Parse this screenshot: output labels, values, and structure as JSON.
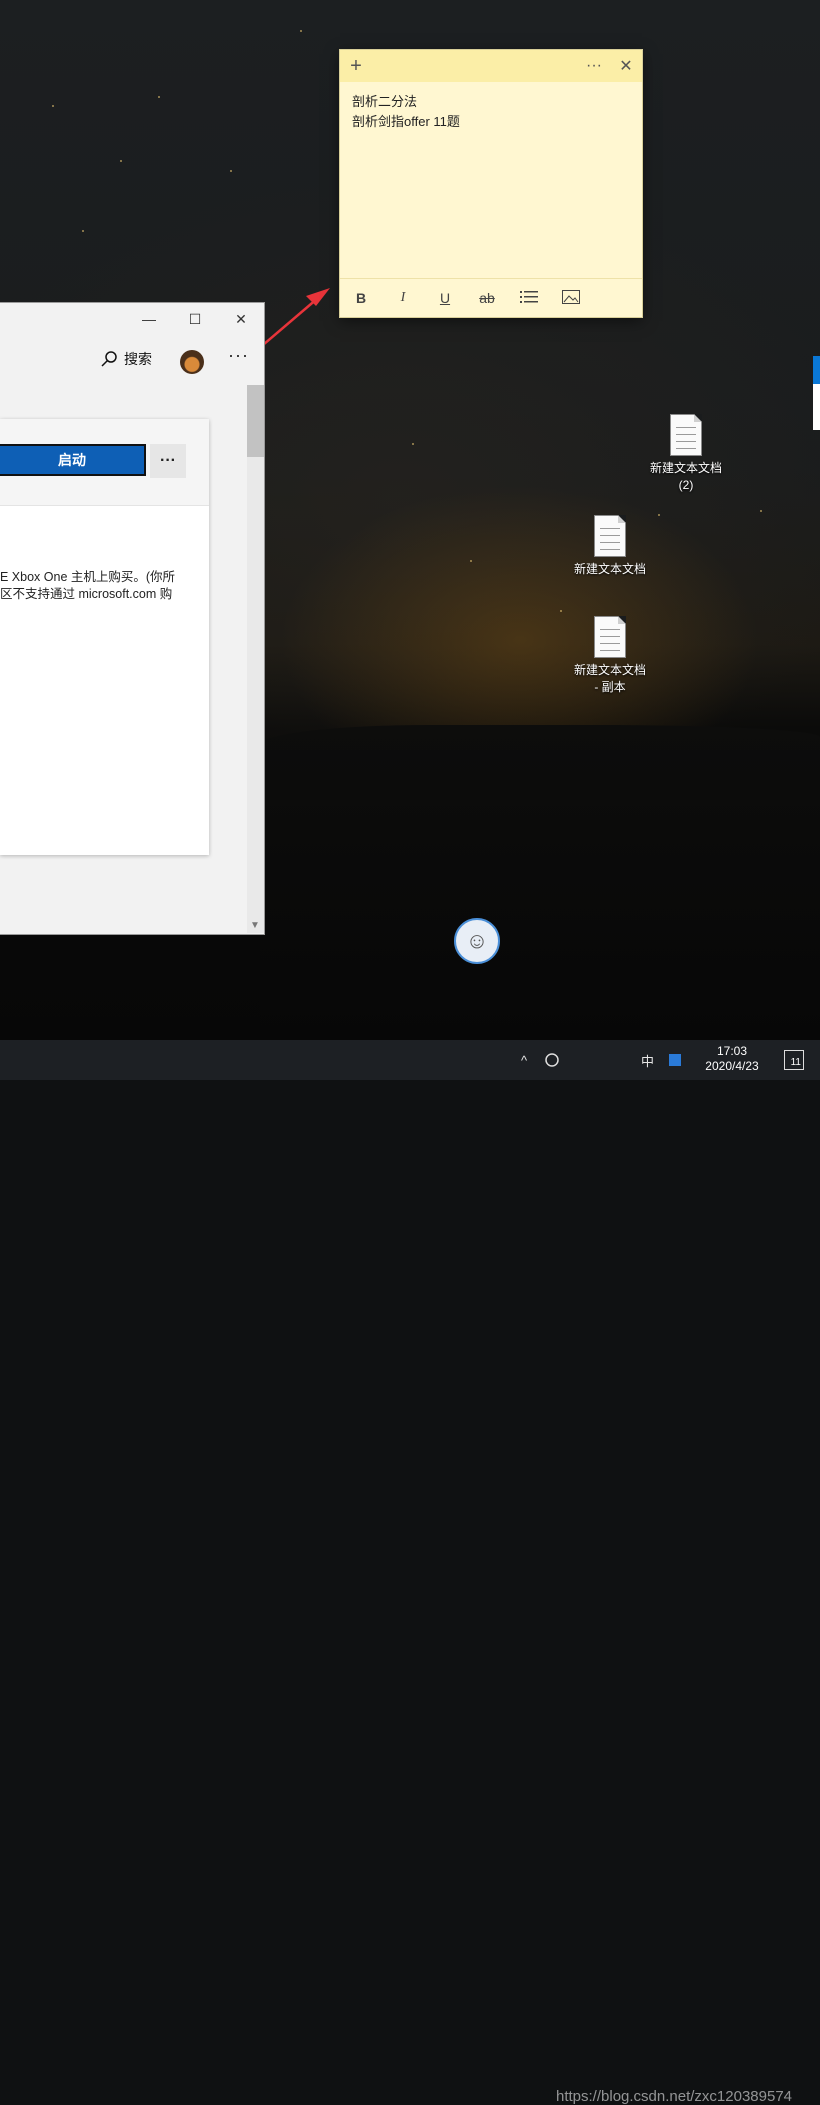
{
  "sticky_note": {
    "add_icon": "plus-icon",
    "menu_icon": "ellipsis-icon",
    "close_icon": "close-icon",
    "lines": [
      "剖析二分法",
      "剖析剑指offer 11题"
    ],
    "toolbar": {
      "bold": "B",
      "italic": "I",
      "underline": "U",
      "strikethrough": "ab",
      "bullets_icon": "list-icon",
      "image_icon": "image-icon"
    },
    "colors": {
      "body": "#fff7d1",
      "header": "#fbeea7"
    }
  },
  "store_window": {
    "controls": {
      "minimize": "—",
      "maximize": "☐",
      "close": "✕"
    },
    "nav": {
      "search_label": "搜索",
      "more": "···"
    },
    "card": {
      "launch_label": "启动",
      "more": "···",
      "text_line1": "E Xbox One 主机上购买。(你所",
      "text_line2": "区不支持通过 microsoft.com 购"
    },
    "accent": "#0e5fb5"
  },
  "desktop_icons": [
    {
      "label_line1": "新建文本文档",
      "label_line2": "(2)"
    },
    {
      "label_line1": "新建文本文档",
      "label_line2": ""
    },
    {
      "label_line1": "新建文本文档",
      "label_line2": "- 副本"
    }
  ],
  "annotation_arrow_color": "#e8343a",
  "taskbar": {
    "chevron": "^",
    "ime": "中",
    "time": "17:03",
    "date": "2020/4/23",
    "notification_count": "11",
    "watermark": "https://blog.csdn.net/zxc120389574"
  }
}
